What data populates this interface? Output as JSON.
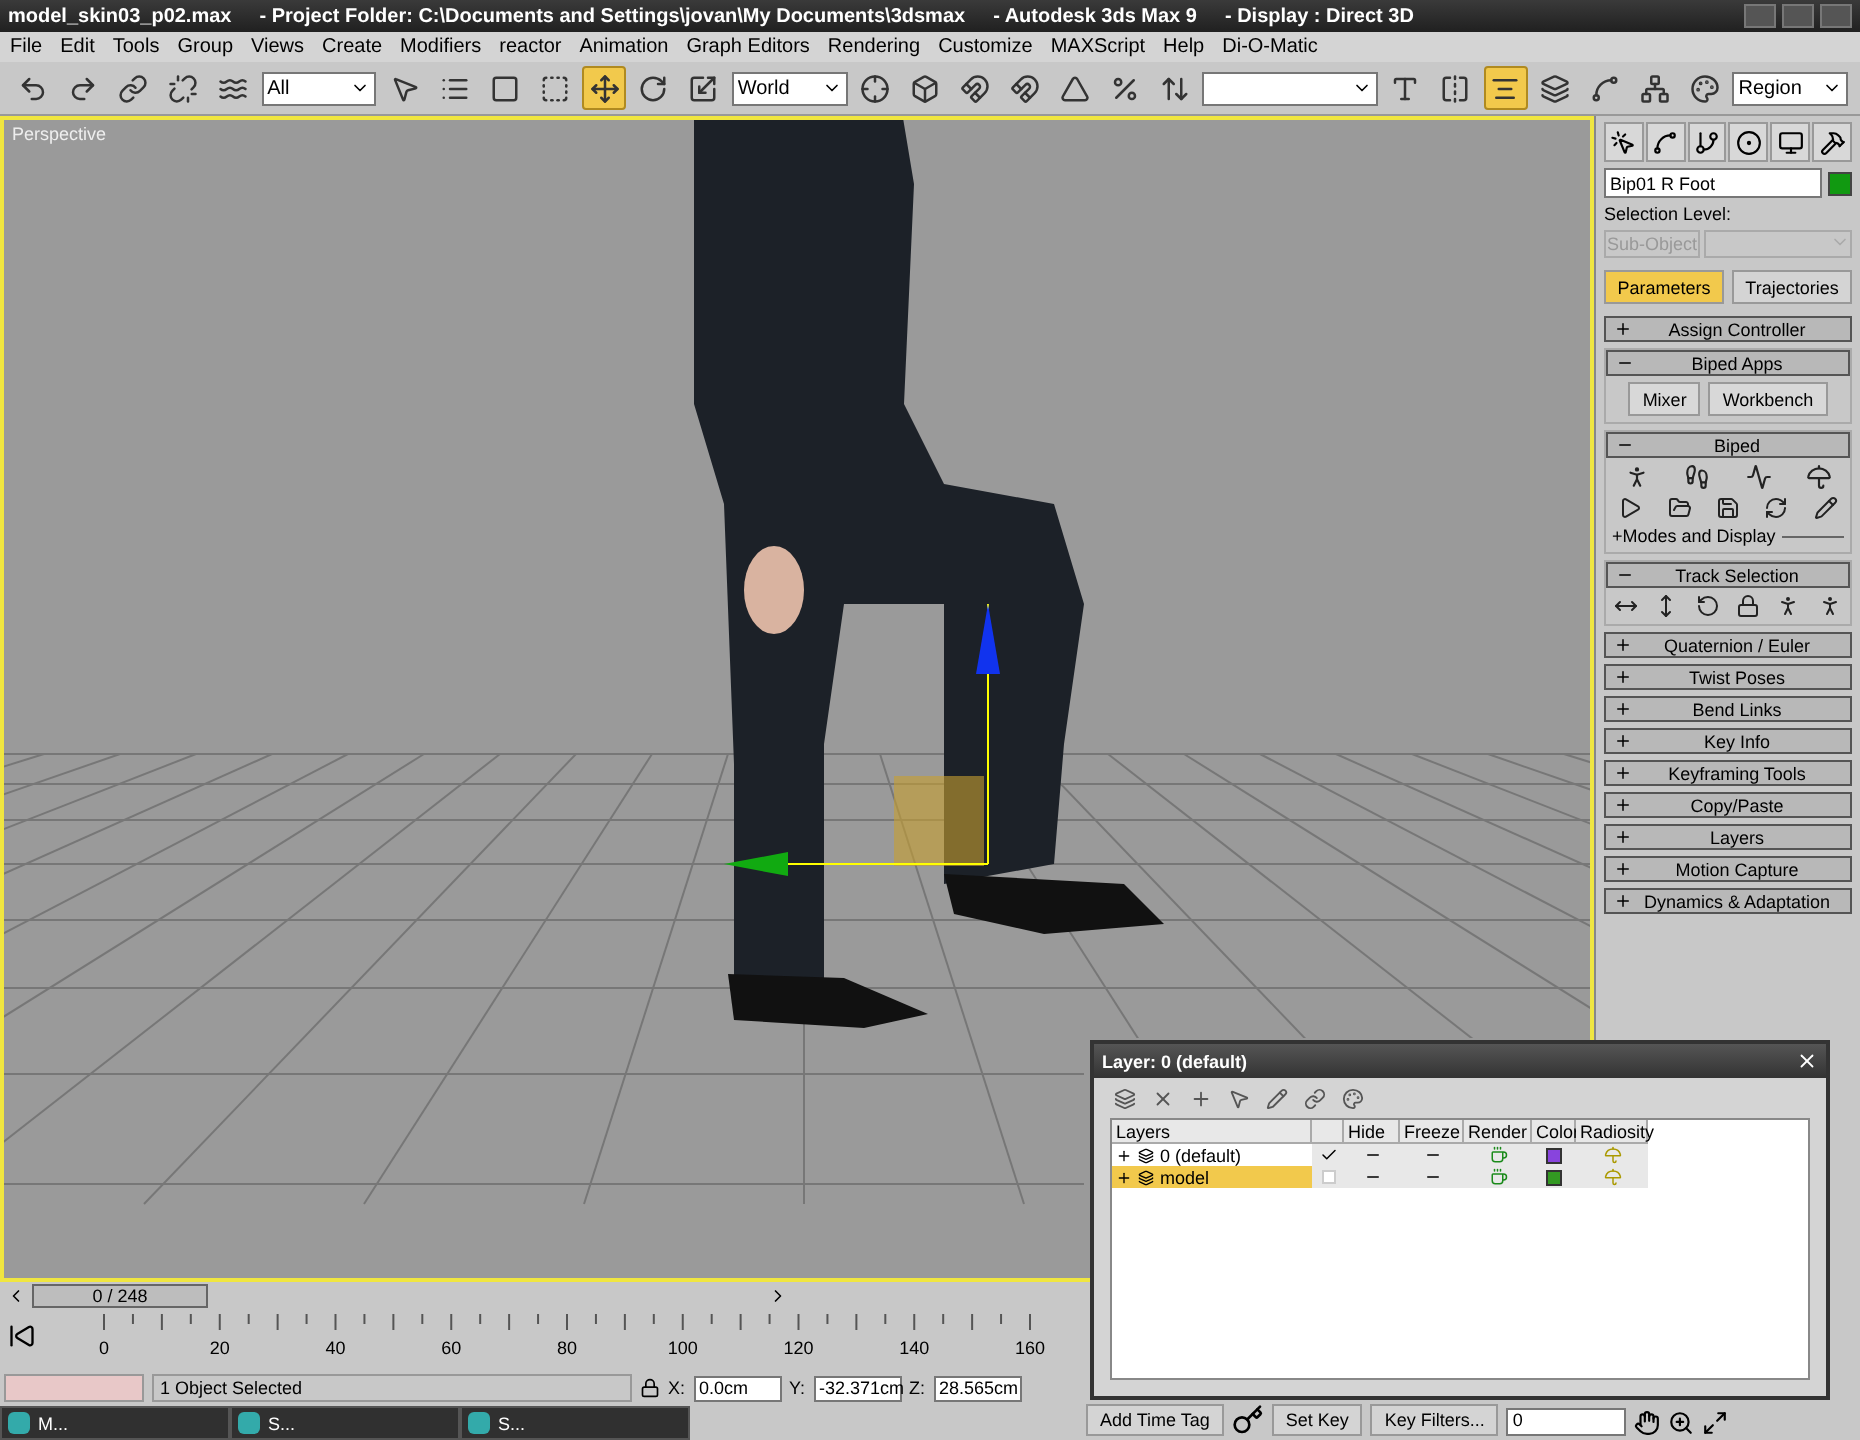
{
  "window": {
    "title_parts": [
      "model_skin03_p02.max",
      "- Project Folder: C:\\Documents and Settings\\jovan\\My Documents\\3dsmax",
      "- Autodesk 3ds Max 9",
      "- Display : Direct 3D"
    ]
  },
  "menu": [
    "File",
    "Edit",
    "Tools",
    "Group",
    "Views",
    "Create",
    "Modifiers",
    "reactor",
    "Animation",
    "Graph Editors",
    "Rendering",
    "Customize",
    "MAXScript",
    "Help",
    "Di-O-Matic"
  ],
  "toolbar": [
    {
      "kind": "icon",
      "selected": false
    },
    {
      "kind": "icon",
      "selected": false
    },
    {
      "kind": "icon",
      "selected": false
    },
    {
      "kind": "icon",
      "selected": false
    },
    {
      "kind": "icon",
      "selected": false
    },
    {
      "kind": "dropdown",
      "value": "All"
    },
    {
      "kind": "icon",
      "selected": false
    },
    {
      "kind": "icon",
      "selected": false
    },
    {
      "kind": "icon",
      "selected": false
    },
    {
      "kind": "icon",
      "selected": false
    },
    {
      "kind": "icon",
      "selected": true
    },
    {
      "kind": "icon",
      "selected": false
    },
    {
      "kind": "icon",
      "selected": false
    },
    {
      "kind": "dropdown",
      "value": "World"
    },
    {
      "kind": "icon",
      "selected": false
    },
    {
      "kind": "icon",
      "selected": false
    },
    {
      "kind": "icon",
      "selected": false
    },
    {
      "kind": "icon",
      "selected": false
    },
    {
      "kind": "icon",
      "selected": false
    },
    {
      "kind": "icon",
      "selected": false
    },
    {
      "kind": "icon",
      "selected": false
    },
    {
      "kind": "wide-dropdown"
    },
    {
      "kind": "icon",
      "selected": false
    },
    {
      "kind": "icon",
      "selected": false
    },
    {
      "kind": "icon",
      "selected": true
    },
    {
      "kind": "icon",
      "selected": false
    },
    {
      "kind": "icon",
      "selected": false
    },
    {
      "kind": "icon",
      "selected": false
    },
    {
      "kind": "icon",
      "selected": false
    },
    {
      "kind": "dropdown",
      "value": "Region"
    }
  ],
  "viewport": {
    "label": "Perspective",
    "active": true
  },
  "command_panel": {
    "object_name": "Bip01 R Foot",
    "selection_level_label": "Selection Level:",
    "sub_object": "Sub-Object",
    "subtabs": [
      {
        "label": "Parameters",
        "selected": true
      },
      {
        "label": "Trajectories",
        "selected": false
      }
    ],
    "rollouts": [
      {
        "label": "Assign Controller",
        "expanded": false
      },
      {
        "label": "Biped Apps",
        "expanded": true,
        "kind": "buttons",
        "buttons": [
          "Mixer",
          "Workbench"
        ]
      },
      {
        "label": "Biped",
        "expanded": true,
        "kind": "biped",
        "sub_label": "+Modes and Display"
      },
      {
        "label": "Track Selection",
        "expanded": true,
        "kind": "track"
      },
      {
        "label": "Quaternion / Euler",
        "expanded": false
      },
      {
        "label": "Twist Poses",
        "expanded": false
      },
      {
        "label": "Bend Links",
        "expanded": false
      },
      {
        "label": "Key Info",
        "expanded": false
      },
      {
        "label": "Keyframing Tools",
        "expanded": false
      },
      {
        "label": "Copy/Paste",
        "expanded": false
      },
      {
        "label": "Layers",
        "expanded": false
      },
      {
        "label": "Motion Capture",
        "expanded": false
      },
      {
        "label": "Dynamics & Adaptation",
        "expanded": false
      }
    ]
  },
  "layer_dialog": {
    "title": "Layer: 0 (default)",
    "columns": [
      "Layers",
      "Hide",
      "Freeze",
      "Render",
      "Color",
      "Radiosity"
    ],
    "rows": [
      {
        "name": "0 (default)",
        "current": true,
        "selected": false,
        "color": "#8844dd"
      },
      {
        "name": "model",
        "current": false,
        "selected": true,
        "color": "#339922"
      }
    ]
  },
  "time_slider": {
    "frame": "0 / 248",
    "level": 0
  },
  "track_bar": {
    "ticks": [
      "0",
      "20",
      "40",
      "60",
      "80",
      "100",
      "120",
      "140",
      "160"
    ]
  },
  "status": {
    "message": "1 Object Selected",
    "x_label": "X:",
    "x": "0.0cm",
    "y_label": "Y:",
    "y": "-32.371cm",
    "z_label": "Z:",
    "z": "28.565cm"
  },
  "taskbar": [
    {
      "label": "M..."
    },
    {
      "label": "S..."
    },
    {
      "label": "S..."
    }
  ],
  "animation": {
    "add_time_tag": "Add Time Tag",
    "set_key": "Set Key",
    "key_filters": "Key Filters...",
    "frame": "0"
  }
}
